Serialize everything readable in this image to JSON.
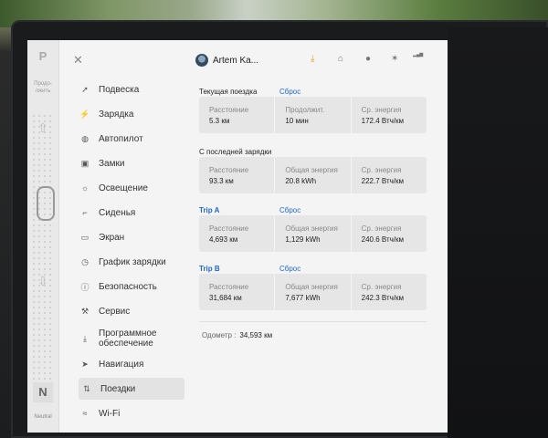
{
  "gear": {
    "p": "P",
    "n": "N",
    "neutral": "Neutral",
    "hint": "Продо-\nлжить"
  },
  "header": {
    "profile_name": "Artem Ka..."
  },
  "sidebar": {
    "items": [
      {
        "label": "Подвеска",
        "icon": "suspension-icon"
      },
      {
        "label": "Зарядка",
        "icon": "charging-bolt-icon"
      },
      {
        "label": "Автопилот",
        "icon": "steering-wheel-icon"
      },
      {
        "label": "Замки",
        "icon": "lock-icon"
      },
      {
        "label": "Освещение",
        "icon": "sun-icon"
      },
      {
        "label": "Сиденья",
        "icon": "seat-icon"
      },
      {
        "label": "Экран",
        "icon": "screen-icon"
      },
      {
        "label": "График зарядки",
        "icon": "clock-icon"
      },
      {
        "label": "Безопасность",
        "icon": "shield-icon"
      },
      {
        "label": "Сервис",
        "icon": "wrench-icon"
      },
      {
        "label": "Программное обеспечение",
        "icon": "download-icon"
      },
      {
        "label": "Навигация",
        "icon": "navigation-arrow-icon"
      },
      {
        "label": "Поездки",
        "icon": "trips-icon"
      },
      {
        "label": "Wi-Fi",
        "icon": "wifi-icon"
      }
    ],
    "active": "Поездки"
  },
  "trips": {
    "current": {
      "title": "Текущая поездка",
      "reset": "Сброс",
      "cells": [
        {
          "label": "Расстояние",
          "value": "5.3 км"
        },
        {
          "label": "Продолжит.",
          "value": "10 мин"
        },
        {
          "label": "Ср. энергия",
          "value": "172.4 Втч/км"
        }
      ]
    },
    "since_charge": {
      "title": "С последней зарядки",
      "cells": [
        {
          "label": "Расстояние",
          "value": "93.3 км"
        },
        {
          "label": "Общая энергия",
          "value": "20.8 kWh"
        },
        {
          "label": "Ср. энергия",
          "value": "222.7 Втч/км"
        }
      ]
    },
    "trip_a": {
      "title": "Trip A",
      "reset": "Сброс",
      "cells": [
        {
          "label": "Расстояние",
          "value": "4,693 км"
        },
        {
          "label": "Общая энергия",
          "value": "1,129 kWh"
        },
        {
          "label": "Ср. энергия",
          "value": "240.6 Втч/км"
        }
      ]
    },
    "trip_b": {
      "title": "Trip B",
      "reset": "Сброс",
      "cells": [
        {
          "label": "Расстояние",
          "value": "31,684 км"
        },
        {
          "label": "Общая энергия",
          "value": "7,677 kWh"
        },
        {
          "label": "Ср. энергия",
          "value": "242.3 Втч/км"
        }
      ]
    },
    "odometer_label": "Одометр :",
    "odometer_value": "34,593 км"
  },
  "colors": {
    "accent": "#1f67c9",
    "download": "#e39a2a"
  }
}
